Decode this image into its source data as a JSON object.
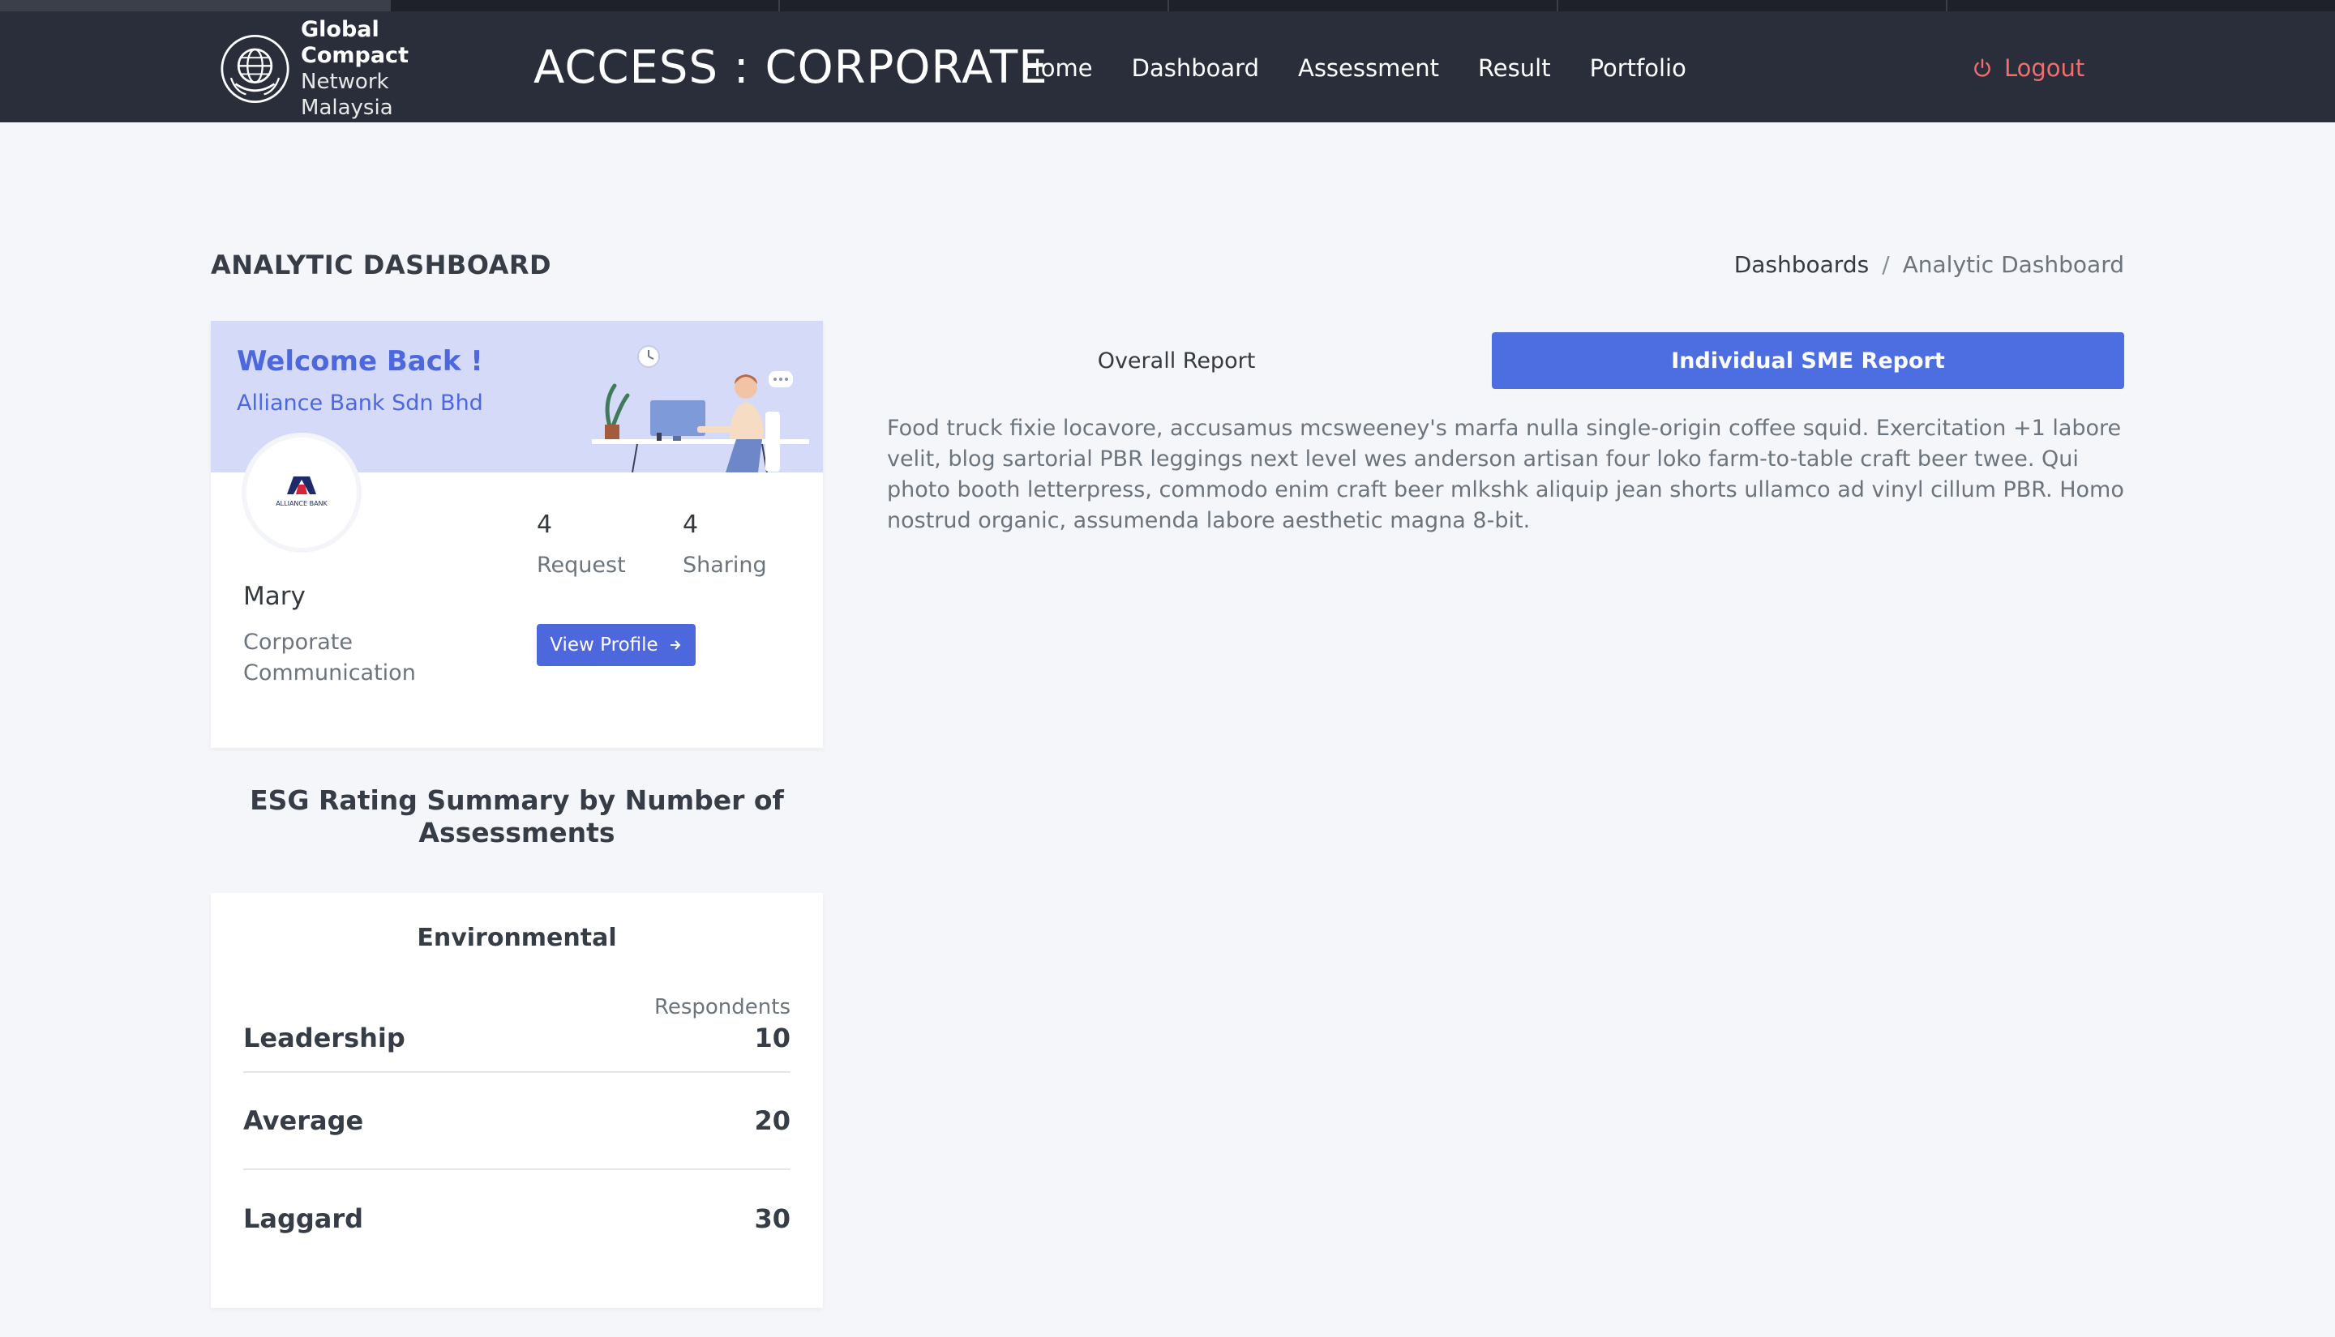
{
  "navbar": {
    "logo": {
      "line1": "Global Compact",
      "line2": "Network Malaysia"
    },
    "title": "ACCESS : CORPORATE",
    "links": [
      {
        "label": "Home"
      },
      {
        "label": "Dashboard"
      },
      {
        "label": "Assessment"
      },
      {
        "label": "Result"
      },
      {
        "label": "Portfolio"
      }
    ],
    "logout_label": "Logout",
    "logout_icon": "power-icon",
    "colors": {
      "background": "#2a2e3b",
      "logout": "#f26d6d"
    }
  },
  "page": {
    "title": "ANALYTIC DASHBOARD",
    "breadcrumb": {
      "parent": "Dashboards",
      "separator": "/",
      "current": "Analytic Dashboard"
    }
  },
  "welcome_card": {
    "heading": "Welcome Back !",
    "company": "Alliance Bank Sdn Bhd",
    "avatar_logo_text": "ALLIANCE BANK",
    "user_name": "Mary",
    "user_role": "Corporate Communication",
    "stats": [
      {
        "value": "4",
        "label": "Request"
      },
      {
        "value": "4",
        "label": "Sharing"
      }
    ],
    "view_profile_label": "View Profile",
    "view_profile_icon": "arrow-right-icon",
    "colors": {
      "banner": "#d5daf8",
      "accent": "#4d67dd"
    }
  },
  "esg_summary": {
    "title": "ESG Rating Summary by Number of Assessments",
    "card_title": "Environmental",
    "column_header": "Respondents",
    "rows": [
      {
        "name": "Leadership",
        "value": "10"
      },
      {
        "name": "Average",
        "value": "20"
      },
      {
        "name": "Laggard",
        "value": "30"
      }
    ]
  },
  "report": {
    "tabs": [
      {
        "label": "Overall Report",
        "active": false
      },
      {
        "label": "Individual SME Report",
        "active": true
      }
    ],
    "content": "Food truck fixie locavore, accusamus mcsweeney's marfa nulla single-origin coffee squid. Exercitation +1 labore velit, blog sartorial PBR leggings next level wes anderson artisan four loko farm-to-table craft beer twee. Qui photo booth letterpress, commodo enim craft beer mlkshk aliquip jean shorts ullamco ad vinyl cillum PBR. Homo nostrud organic, assumenda labore aesthetic magna 8-bit.",
    "colors": {
      "active_tab": "#4d6ee0"
    }
  }
}
